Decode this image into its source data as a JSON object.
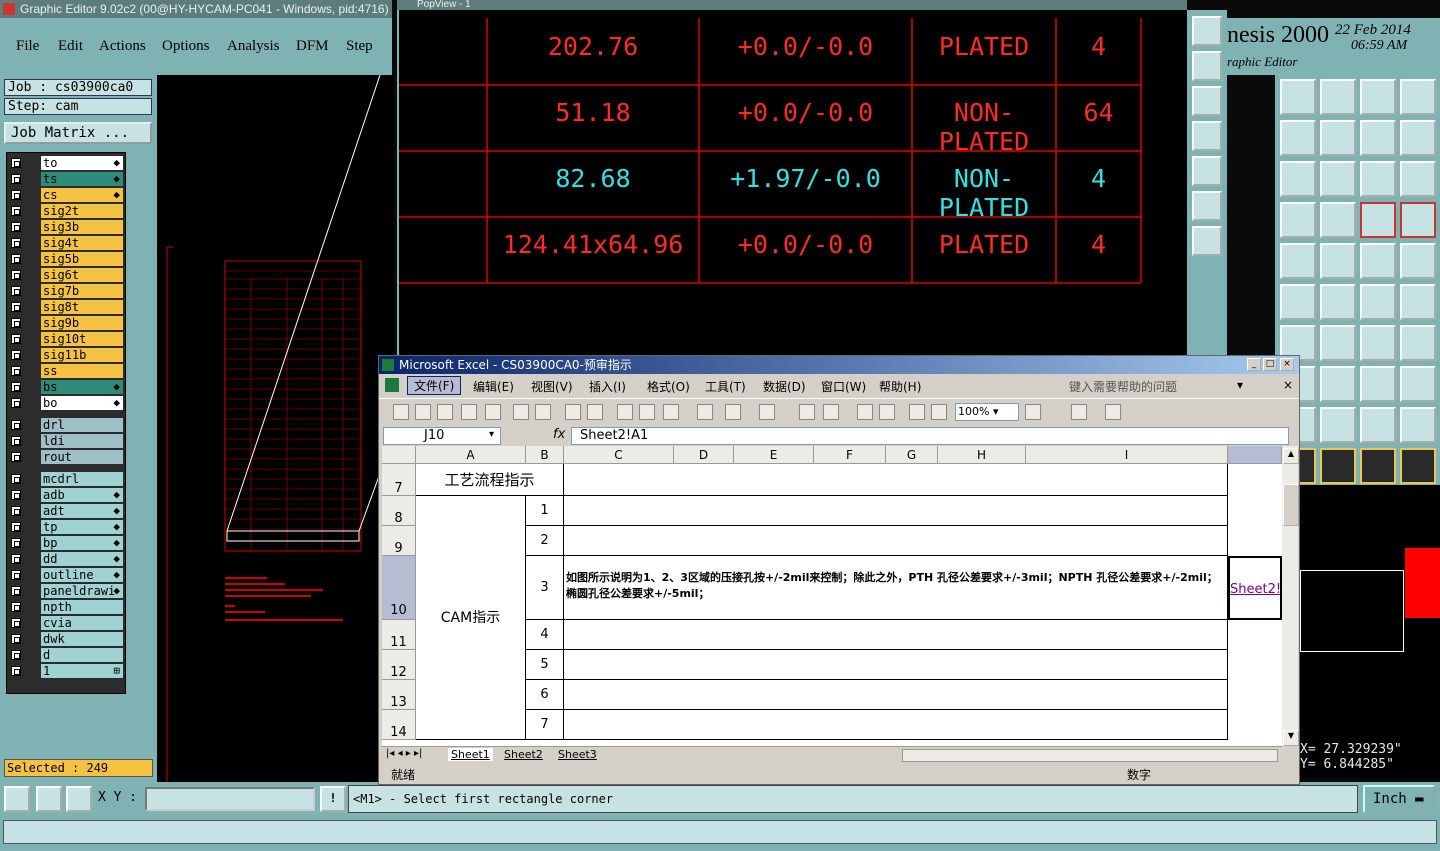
{
  "ge": {
    "title": "Graphic Editor 9.02c2 (00@HY-HYCAM-PC041 - Windows, pid:4716)",
    "menu": [
      "File",
      "Edit",
      "Actions",
      "Options",
      "Analysis",
      "DFM",
      "Step"
    ],
    "job": "Job : cs03900ca0",
    "step": "Step: cam",
    "job_matrix": "Job Matrix ...",
    "layers": [
      {
        "name": "to",
        "color": "#ffffff",
        "mark": "◆"
      },
      {
        "name": "ts",
        "color": "#2e8b7a",
        "mark": "◆"
      },
      {
        "name": "cs",
        "color": "#f5c242",
        "mark": "◆"
      },
      {
        "name": "sig2t",
        "color": "#f5c242",
        "mark": ""
      },
      {
        "name": "sig3b",
        "color": "#f5c242",
        "mark": ""
      },
      {
        "name": "sig4t",
        "color": "#f5c242",
        "mark": ""
      },
      {
        "name": "sig5b",
        "color": "#f5c242",
        "mark": ""
      },
      {
        "name": "sig6t",
        "color": "#f5c242",
        "mark": ""
      },
      {
        "name": "sig7b",
        "color": "#f5c242",
        "mark": ""
      },
      {
        "name": "sig8t",
        "color": "#f5c242",
        "mark": ""
      },
      {
        "name": "sig9b",
        "color": "#f5c242",
        "mark": ""
      },
      {
        "name": "sig10t",
        "color": "#f5c242",
        "mark": ""
      },
      {
        "name": "sig11b",
        "color": "#f5c242",
        "mark": ""
      },
      {
        "name": "ss",
        "color": "#f5c242",
        "mark": ""
      },
      {
        "name": "bs",
        "color": "#2e8b7a",
        "mark": "◆"
      },
      {
        "name": "bo",
        "color": "#ffffff",
        "mark": "◆"
      },
      {
        "name": "drl",
        "color": "#9fbfc6",
        "mark": ""
      },
      {
        "name": "ldi",
        "color": "#9fbfc6",
        "mark": ""
      },
      {
        "name": "rout",
        "color": "#9fbfc6",
        "mark": ""
      },
      {
        "name": "mcdrl",
        "color": "#9fd3d3",
        "mark": ""
      },
      {
        "name": "adb",
        "color": "#9fd3d3",
        "mark": "◆"
      },
      {
        "name": "adt",
        "color": "#9fd3d3",
        "mark": "◆"
      },
      {
        "name": "tp",
        "color": "#9fd3d3",
        "mark": "◆"
      },
      {
        "name": "bp",
        "color": "#9fd3d3",
        "mark": "◆"
      },
      {
        "name": "dd",
        "color": "#9fd3d3",
        "mark": "◆"
      },
      {
        "name": "outline",
        "color": "#9fd3d3",
        "mark": "◆"
      },
      {
        "name": "paneldrawi",
        "color": "#9fd3d3",
        "mark": "◆"
      },
      {
        "name": "npth",
        "color": "#9fd3d3",
        "mark": ""
      },
      {
        "name": "cvia",
        "color": "#9fd3d3",
        "mark": ""
      },
      {
        "name": "dwk",
        "color": "#9fd3d3",
        "mark": ""
      },
      {
        "name": "d",
        "color": "#9fd3d3",
        "mark": ""
      },
      {
        "name": "1",
        "color": "#9fd3d3",
        "mark": "⊞"
      }
    ],
    "selected": "Selected : 249",
    "xy_label": "X Y :",
    "message": "<M1> - Select first rectangle corner",
    "unit": "Inch"
  },
  "popview": {
    "title": "PopView - 1",
    "rows": [
      {
        "size": "202.76",
        "tol": "+0.0/-0.0",
        "type": "PLATED",
        "qty": "4",
        "color": "#ff2a2a"
      },
      {
        "size": "51.18",
        "tol": "+0.0/-0.0",
        "type": "NON-PLATED",
        "qty": "64",
        "color": "#ff2a2a"
      },
      {
        "size": "82.68",
        "tol": "+1.97/-0.0",
        "type": "NON-PLATED",
        "qty": "4",
        "color": "#33e0e0"
      },
      {
        "size": "124.41x64.96",
        "tol": "+0.0/-0.0",
        "type": "PLATED",
        "qty": "4",
        "color": "#ff2a2a"
      }
    ]
  },
  "brand": {
    "name": "nesis 2000",
    "subtitle": "raphic Editor",
    "date": "22 Feb 2014",
    "time": "06:59 AM"
  },
  "coords": {
    "x": "27.329239\"",
    "y": "6.844285\""
  },
  "excel": {
    "title": "Microsoft Excel - CS03900CA0-预审指示",
    "menu": [
      "文件(F)",
      "编辑(E)",
      "视图(V)",
      "插入(I)",
      "格式(O)",
      "工具(T)",
      "数据(D)",
      "窗口(W)",
      "帮助(H)"
    ],
    "help_placeholder": "键入需要帮助的问题",
    "zoom": "100%",
    "namebox": "J10",
    "fx": "fx",
    "formula": "Sheet2!A1",
    "columns": [
      "A",
      "B",
      "C",
      "D",
      "E",
      "F",
      "G",
      "H",
      "I"
    ],
    "rows": [
      "7",
      "8",
      "9",
      "10",
      "11",
      "12",
      "13",
      "14"
    ],
    "cell_a7": "工艺流程指示",
    "cell_a_cam": "CAM指示",
    "bnums": [
      "1",
      "2",
      "3",
      "4",
      "5",
      "6",
      "7"
    ],
    "instruction": "如图所示说明为1、2、3区域的压接孔按+/-2mil来控制；除此之外，PTH 孔径公差要求+/-3mil；NPTH 孔径公差要求+/-2mil；椭圆孔径公差要求+/-5mil；",
    "link": "Sheet2!",
    "sheets": [
      "Sheet1",
      "Sheet2",
      "Sheet3"
    ],
    "status": "就绪",
    "status_num": "数字"
  }
}
